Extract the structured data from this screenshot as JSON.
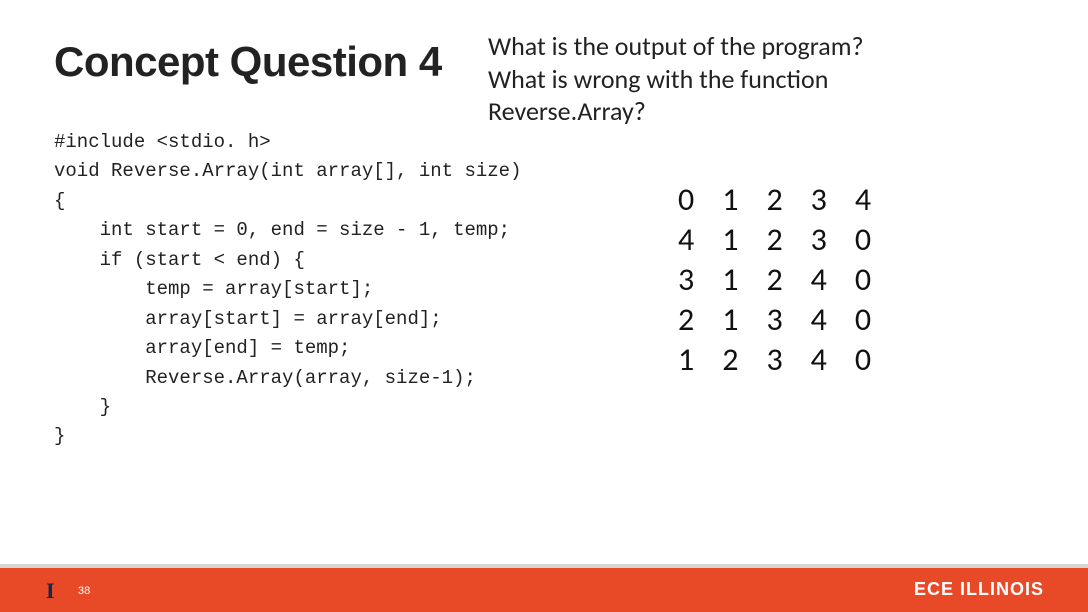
{
  "title": "Concept Question 4",
  "question_line1": "What is the output of the program?",
  "question_line2": "What is wrong with the function",
  "question_line3": "Reverse.Array?",
  "code": "#include <stdio. h>\nvoid Reverse.Array(int array[], int size)\n{\n    int start = 0, end = size - 1, temp;\n    if (start < end) {\n        temp = array[start];\n        array[start] = array[end];\n        array[end] = temp;\n        Reverse.Array(array, size-1);\n    }\n}",
  "matrix": [
    [
      "0",
      "1",
      "2",
      "3",
      "4"
    ],
    [
      "4",
      "1",
      "2",
      "3",
      "0"
    ],
    [
      "3",
      "1",
      "2",
      "4",
      "0"
    ],
    [
      "2",
      "1",
      "3",
      "4",
      "0"
    ],
    [
      "1",
      "2",
      "3",
      "4",
      "0"
    ]
  ],
  "footer": {
    "logo": "I",
    "page": "38",
    "dept": "ECE ILLINOIS"
  }
}
